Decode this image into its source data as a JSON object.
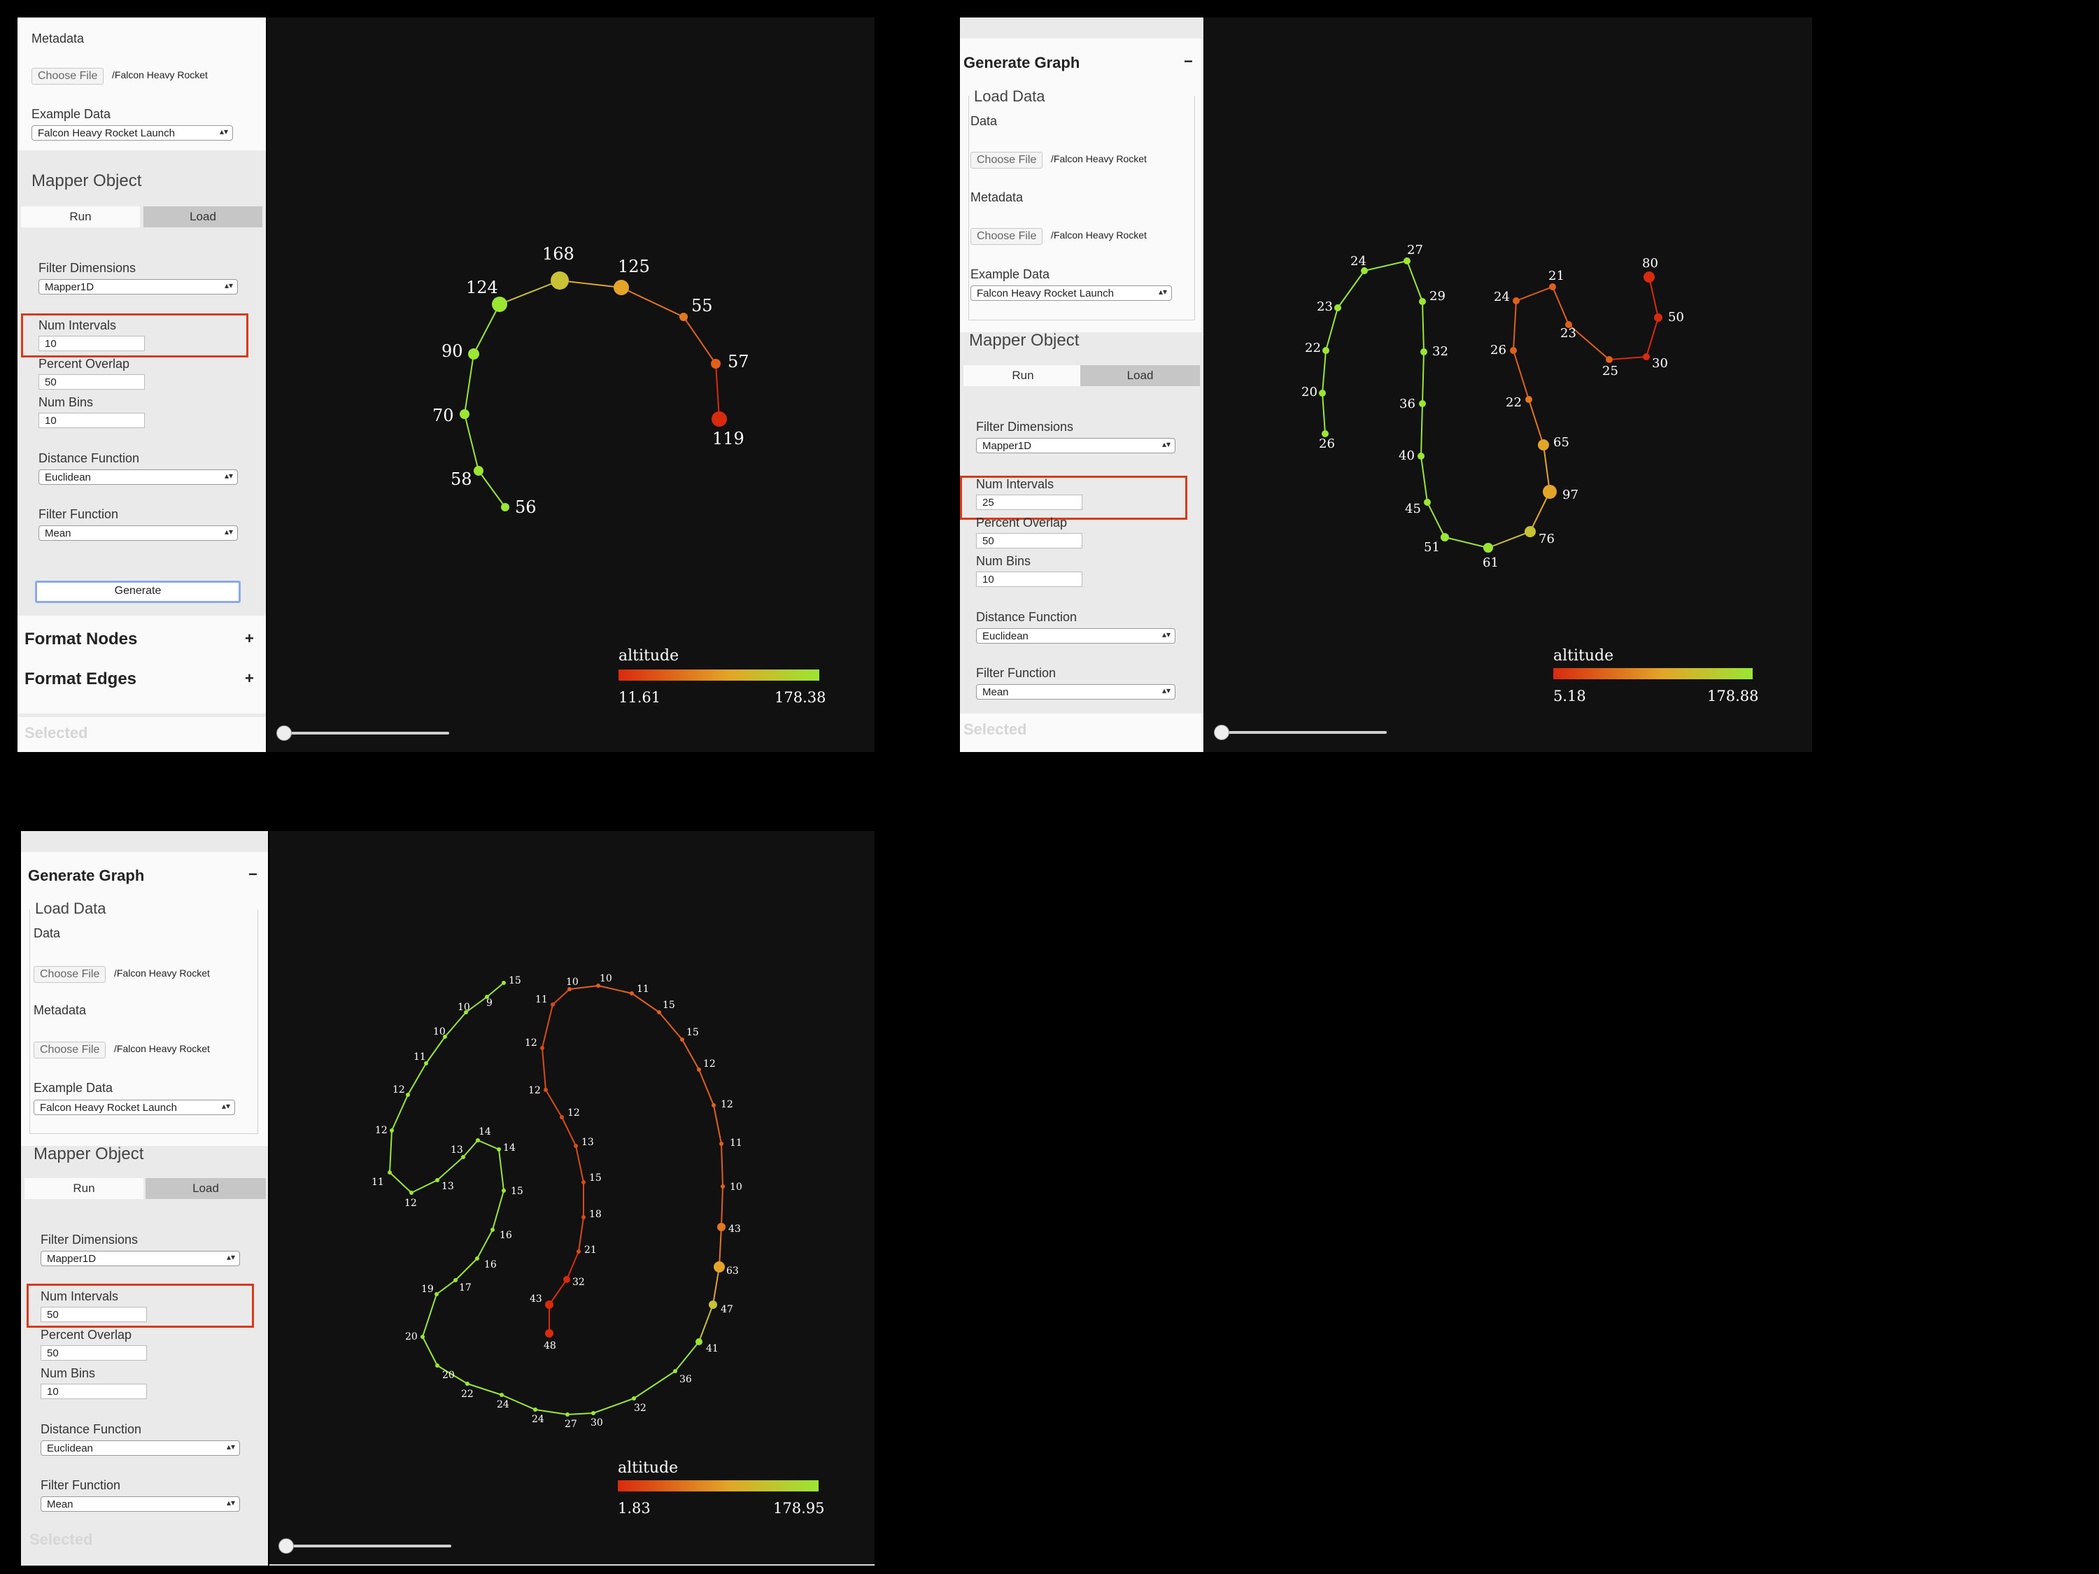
{
  "colors": {
    "low": "#d92a0e",
    "mid": "#e3a528",
    "high": "#9be633",
    "highlight": "#d63b1b"
  },
  "ui": {
    "metadata_label": "Metadata",
    "data_label": "Data",
    "choose_file": "Choose File",
    "file_name": "/Falcon Heavy Rocket",
    "example_data_label": "Example Data",
    "example_data_value": "Falcon Heavy Rocket Launch",
    "mapper_object_label": "Mapper Object",
    "tab_run": "Run",
    "tab_load": "Load",
    "filter_dimensions_label": "Filter Dimensions",
    "filter_dimensions_value": "Mapper1D",
    "num_intervals_label": "Num Intervals",
    "percent_overlap_label": "Percent Overlap",
    "percent_overlap_value": "50",
    "num_bins_label": "Num Bins",
    "num_bins_value": "10",
    "distance_function_label": "Distance Function",
    "distance_function_value": "Euclidean",
    "filter_function_label": "Filter Function",
    "filter_function_value": "Mean",
    "generate_button": "Generate",
    "format_nodes": "Format Nodes",
    "format_edges": "Format Edges",
    "selected_label": "Selected",
    "generate_graph_header": "Generate Graph",
    "load_data_legend": "Load Data",
    "collapse_symbol": "−",
    "expand_symbol": "+",
    "select_arrow": "▴▾"
  },
  "panels": [
    {
      "num_intervals": "10",
      "legend": {
        "title": "altitude",
        "min": "11.61",
        "max": "178.38"
      },
      "graph": {
        "nodes": [
          {
            "label": "56",
            "c": "high"
          },
          {
            "label": "58",
            "c": "high"
          },
          {
            "label": "70",
            "c": "high"
          },
          {
            "label": "90",
            "c": "high"
          },
          {
            "label": "124",
            "c": "high"
          },
          {
            "label": "168",
            "c": "ymid"
          },
          {
            "label": "125",
            "c": "mid"
          },
          {
            "label": "55",
            "c": "omid"
          },
          {
            "label": "57",
            "c": "orange"
          },
          {
            "label": "119",
            "c": "low"
          }
        ],
        "edges": [
          [
            0,
            1
          ],
          [
            1,
            2
          ],
          [
            2,
            3
          ],
          [
            3,
            4
          ],
          [
            4,
            5
          ],
          [
            5,
            6
          ],
          [
            6,
            7
          ],
          [
            7,
            8
          ],
          [
            8,
            9
          ]
        ]
      }
    },
    {
      "num_intervals": "25",
      "legend": {
        "title": "altitude",
        "min": "5.18",
        "max": "178.88"
      },
      "graph": {
        "nodes": [
          {
            "label": "26",
            "c": "high"
          },
          {
            "label": "20",
            "c": "high"
          },
          {
            "label": "22",
            "c": "high"
          },
          {
            "label": "23",
            "c": "high"
          },
          {
            "label": "24",
            "c": "high"
          },
          {
            "label": "27",
            "c": "high"
          },
          {
            "label": "29",
            "c": "high"
          },
          {
            "label": "32",
            "c": "high"
          },
          {
            "label": "36",
            "c": "high"
          },
          {
            "label": "40",
            "c": "high"
          },
          {
            "label": "45",
            "c": "high"
          },
          {
            "label": "51",
            "c": "high"
          },
          {
            "label": "61",
            "c": "high"
          },
          {
            "label": "76",
            "c": "ymid"
          },
          {
            "label": "97",
            "c": "mid"
          },
          {
            "label": "65",
            "c": "mid"
          },
          {
            "label": "22",
            "c": "omid"
          },
          {
            "label": "26",
            "c": "orange"
          },
          {
            "label": "24",
            "c": "orange"
          },
          {
            "label": "21",
            "c": "orange"
          },
          {
            "label": "23",
            "c": "orange"
          },
          {
            "label": "25",
            "c": "orange"
          },
          {
            "label": "30",
            "c": "low"
          },
          {
            "label": "50",
            "c": "low"
          },
          {
            "label": "80",
            "c": "low"
          }
        ],
        "edges": [
          [
            0,
            1
          ],
          [
            1,
            2
          ],
          [
            2,
            3
          ],
          [
            3,
            4
          ],
          [
            4,
            5
          ],
          [
            5,
            6
          ],
          [
            6,
            7
          ],
          [
            7,
            8
          ],
          [
            8,
            9
          ],
          [
            9,
            10
          ],
          [
            10,
            11
          ],
          [
            11,
            12
          ],
          [
            12,
            13
          ],
          [
            13,
            14
          ],
          [
            14,
            15
          ],
          [
            15,
            16
          ],
          [
            16,
            17
          ],
          [
            17,
            18
          ],
          [
            18,
            19
          ],
          [
            19,
            20
          ],
          [
            20,
            21
          ],
          [
            21,
            22
          ],
          [
            22,
            23
          ],
          [
            23,
            24
          ]
        ]
      }
    },
    {
      "num_intervals": "50",
      "legend": {
        "title": "altitude",
        "min": "1.83",
        "max": "178.95"
      },
      "graph": {
        "nodes": [
          {
            "label": "15",
            "c": "high"
          },
          {
            "label": "9",
            "c": "high"
          },
          {
            "label": "10",
            "c": "high"
          },
          {
            "label": "10",
            "c": "high"
          },
          {
            "label": "11",
            "c": "high"
          },
          {
            "label": "12",
            "c": "high"
          },
          {
            "label": "12",
            "c": "high"
          },
          {
            "label": "11",
            "c": "high"
          },
          {
            "label": "12",
            "c": "high"
          },
          {
            "label": "13",
            "c": "high"
          },
          {
            "label": "13",
            "c": "high"
          },
          {
            "label": "14",
            "c": "high"
          },
          {
            "label": "14",
            "c": "high"
          },
          {
            "label": "15",
            "c": "high"
          },
          {
            "label": "16",
            "c": "high"
          },
          {
            "label": "16",
            "c": "high"
          },
          {
            "label": "17",
            "c": "high"
          },
          {
            "label": "19",
            "c": "high"
          },
          {
            "label": "20",
            "c": "high"
          },
          {
            "label": "20",
            "c": "high"
          },
          {
            "label": "22",
            "c": "high"
          },
          {
            "label": "24",
            "c": "high"
          },
          {
            "label": "24",
            "c": "high"
          },
          {
            "label": "27",
            "c": "high"
          },
          {
            "label": "30",
            "c": "high"
          },
          {
            "label": "32",
            "c": "high"
          },
          {
            "label": "36",
            "c": "high"
          },
          {
            "label": "41",
            "c": "high"
          },
          {
            "label": "47",
            "c": "ymid"
          },
          {
            "label": "63",
            "c": "mid"
          },
          {
            "label": "43",
            "c": "omid"
          },
          {
            "label": "10",
            "c": "orange"
          },
          {
            "label": "11",
            "c": "orange"
          },
          {
            "label": "12",
            "c": "orange"
          },
          {
            "label": "12",
            "c": "orange"
          },
          {
            "label": "15",
            "c": "orange"
          },
          {
            "label": "15",
            "c": "orange"
          },
          {
            "label": "11",
            "c": "orange"
          },
          {
            "label": "10",
            "c": "orange"
          },
          {
            "label": "10",
            "c": "orange"
          },
          {
            "label": "11",
            "c": "lowo"
          },
          {
            "label": "12",
            "c": "lowo"
          },
          {
            "label": "12",
            "c": "lowo"
          },
          {
            "label": "12",
            "c": "lowo"
          },
          {
            "label": "13",
            "c": "lowo"
          },
          {
            "label": "15",
            "c": "lowo"
          },
          {
            "label": "18",
            "c": "lowo"
          },
          {
            "label": "21",
            "c": "lowo"
          },
          {
            "label": "32",
            "c": "low"
          },
          {
            "label": "43",
            "c": "low"
          },
          {
            "label": "48",
            "c": "low"
          }
        ],
        "edges": [
          [
            0,
            1
          ],
          [
            1,
            2
          ],
          [
            2,
            3
          ],
          [
            3,
            4
          ],
          [
            4,
            5
          ],
          [
            5,
            6
          ],
          [
            6,
            7
          ],
          [
            7,
            8
          ],
          [
            8,
            9
          ],
          [
            9,
            10
          ],
          [
            10,
            11
          ],
          [
            11,
            12
          ],
          [
            12,
            13
          ],
          [
            13,
            14
          ],
          [
            14,
            15
          ],
          [
            15,
            16
          ],
          [
            16,
            17
          ],
          [
            17,
            18
          ],
          [
            18,
            19
          ],
          [
            19,
            20
          ],
          [
            20,
            21
          ],
          [
            21,
            22
          ],
          [
            22,
            23
          ],
          [
            23,
            24
          ],
          [
            24,
            25
          ],
          [
            25,
            26
          ],
          [
            26,
            27
          ],
          [
            27,
            28
          ],
          [
            28,
            29
          ],
          [
            29,
            30
          ],
          [
            30,
            31
          ],
          [
            31,
            32
          ],
          [
            32,
            33
          ],
          [
            33,
            34
          ],
          [
            34,
            35
          ],
          [
            35,
            36
          ],
          [
            36,
            37
          ],
          [
            37,
            38
          ],
          [
            38,
            39
          ],
          [
            39,
            40
          ],
          [
            40,
            41
          ],
          [
            41,
            42
          ],
          [
            42,
            43
          ],
          [
            43,
            44
          ],
          [
            44,
            45
          ],
          [
            45,
            46
          ],
          [
            46,
            47
          ],
          [
            47,
            48
          ],
          [
            48,
            49
          ],
          [
            49,
            50
          ]
        ]
      }
    }
  ]
}
